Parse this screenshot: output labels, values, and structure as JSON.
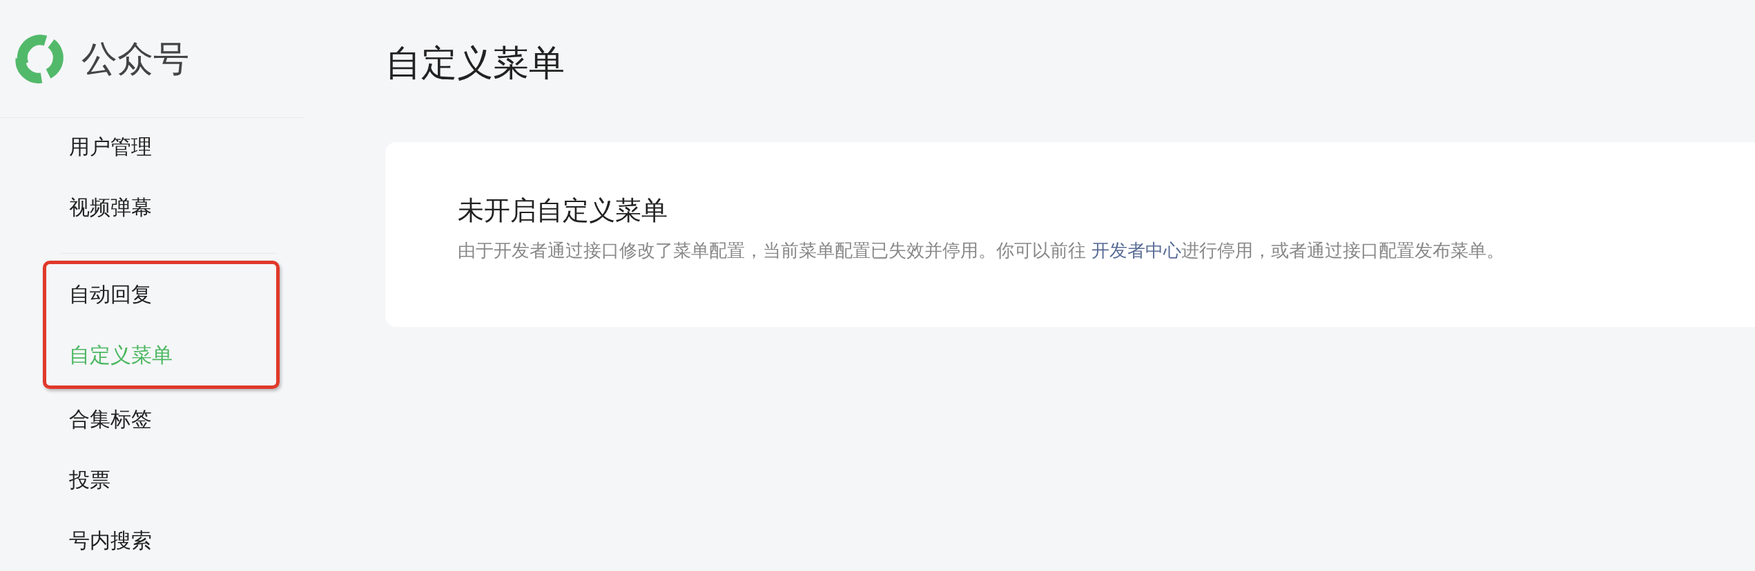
{
  "sidebar": {
    "brand": "公众号",
    "sections": [
      {
        "items": [
          {
            "label": "用户管理",
            "selected": false,
            "highlighted": false
          },
          {
            "label": "视频弹幕",
            "selected": false,
            "highlighted": false
          }
        ]
      },
      {
        "items": [
          {
            "label": "自动回复",
            "selected": false,
            "highlighted": true
          },
          {
            "label": "自定义菜单",
            "selected": true,
            "highlighted": true
          },
          {
            "label": "合集标签",
            "selected": false,
            "highlighted": false
          },
          {
            "label": "投票",
            "selected": false,
            "highlighted": false
          },
          {
            "label": "号内搜索",
            "selected": false,
            "highlighted": false
          }
        ]
      }
    ]
  },
  "page": {
    "title": "自定义菜单",
    "notice": {
      "title": "未开启自定义菜单",
      "text_before": "由于开发者通过接口修改了菜单配置，当前菜单配置已失效并停用。你可以前往 ",
      "link": "开发者中心",
      "text_after": "进行停用，或者通过接口配置发布菜单。"
    }
  }
}
